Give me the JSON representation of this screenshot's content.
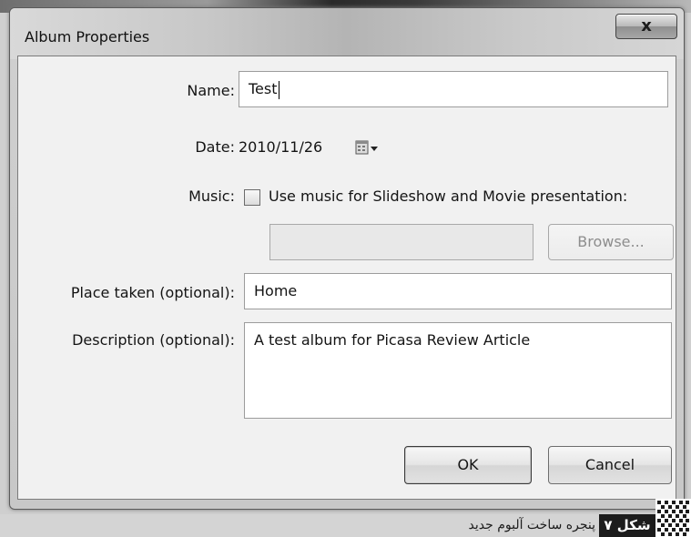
{
  "window": {
    "title": "Album Properties",
    "close_glyph": "x"
  },
  "form": {
    "name_label": "Name:",
    "name_value": "Test",
    "date_label": "Date:",
    "date_value": "2010/11/26",
    "date_icon": "calendar-dropdown-icon",
    "music_label": "Music:",
    "music_checkbox_checked": false,
    "music_checkbox_label": "Use music for Slideshow and Movie presentation:",
    "music_path_value": "",
    "browse_label": "Browse...",
    "place_label": "Place taken (optional):",
    "place_value": "Home",
    "description_label": "Description (optional):",
    "description_value": "A test album for Picasa Review Article"
  },
  "buttons": {
    "ok_label": "OK",
    "cancel_label": "Cancel"
  },
  "caption": {
    "figure_label": "شکل ۷",
    "figure_text": "پنجره ساخت آلبوم جدید"
  },
  "colors": {
    "caption_label_bg": "#1c1c1c",
    "dialog_bg": "#f1f1f1"
  }
}
